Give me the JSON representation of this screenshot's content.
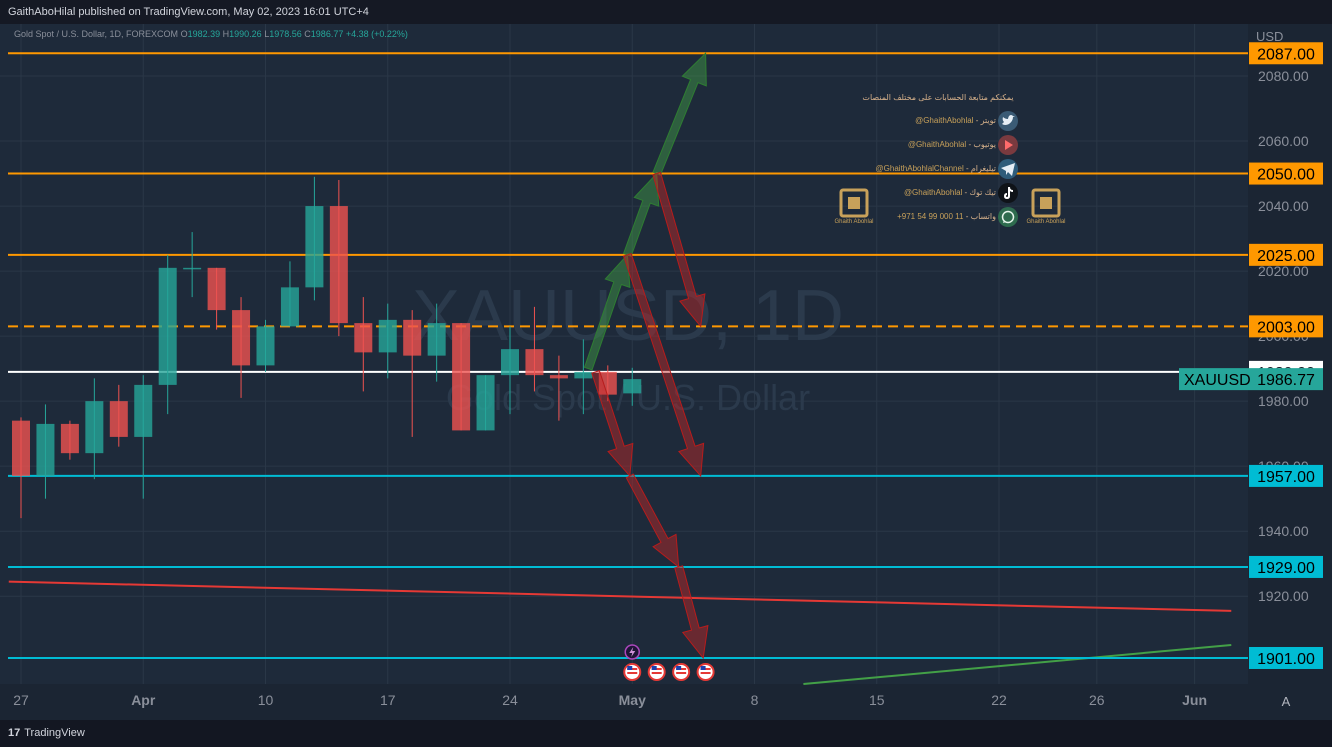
{
  "header": {
    "published": "GaithAboHilal published on TradingView.com, May 02, 2023 16:01 UTC+4"
  },
  "legend": {
    "symbol": "Gold Spot / U.S. Dollar, 1D, FOREXCOM",
    "o_label": "O",
    "o_value": "1982.39",
    "h_label": "H",
    "h_value": "1990.26",
    "l_label": "L",
    "l_value": "1978.56",
    "c_label": "C",
    "c_value": "1986.77",
    "change": "+4.38 (+0.22%)"
  },
  "footer": {
    "logo": "TradingView"
  },
  "watermark": {
    "line1": "XAUUSD, 1D",
    "line2": "Gold Spot / U.S. Dollar"
  },
  "social": {
    "heading": "يمكنكم متابعة الحسابات على مختلف المنصات",
    "items": [
      {
        "handle": "@GhaithAbohlal",
        "label": "تويتر",
        "icon": "twitter-icon",
        "color": "#1d9bf0"
      },
      {
        "handle": "@GhaithAbohlal",
        "label": "يوتيوب",
        "icon": "youtube-icon",
        "color": "#e53935"
      },
      {
        "handle": "@GhaithAbohlalChannel",
        "label": "تيليغرام",
        "icon": "telegram-icon",
        "color": "#2aa3de"
      },
      {
        "handle": "@GhaithAbohlal",
        "label": "تيك توك",
        "icon": "tiktok-icon",
        "color": "#111111"
      },
      {
        "handle": "+971 54 99 000 11",
        "label": "واتساب",
        "icon": "whatsapp-icon",
        "color": "#25d366"
      }
    ],
    "logo_caption": "Ghaith Abohlal"
  },
  "colors": {
    "background": "#1e2a3a",
    "up": "#26a69a",
    "down": "#ef5350",
    "orange": "#ff9800",
    "cyan": "#00bcd4",
    "price_tag": "#26a69a"
  },
  "chart_data": {
    "type": "candlestick",
    "symbol": "XAUUSD",
    "timeframe": "1D",
    "currency": "USD",
    "ylim": [
      1893,
      2096
    ],
    "yticks": [
      1920,
      1940,
      1960,
      1980,
      2000,
      2020,
      2040,
      2060,
      2080
    ],
    "xticks": [
      {
        "label": "27",
        "i": 0
      },
      {
        "label": "Apr",
        "i": 5
      },
      {
        "label": "10",
        "i": 10
      },
      {
        "label": "17",
        "i": 15
      },
      {
        "label": "24",
        "i": 20
      },
      {
        "label": "May",
        "i": 25
      },
      {
        "label": "8",
        "i": 30
      },
      {
        "label": "15",
        "i": 35
      },
      {
        "label": "22",
        "i": 40
      },
      {
        "label": "26",
        "i": 44
      },
      {
        "label": "Jun",
        "i": 48
      }
    ],
    "candles": [
      {
        "o": 1974,
        "h": 1975,
        "l": 1944,
        "c": 1957
      },
      {
        "o": 1957,
        "h": 1979,
        "l": 1950,
        "c": 1973
      },
      {
        "o": 1973,
        "h": 1974,
        "l": 1962,
        "c": 1964
      },
      {
        "o": 1964,
        "h": 1987,
        "l": 1956,
        "c": 1980
      },
      {
        "o": 1980,
        "h": 1985,
        "l": 1966,
        "c": 1969
      },
      {
        "o": 1969,
        "h": 1988,
        "l": 1950,
        "c": 1985
      },
      {
        "o": 1985,
        "h": 2025,
        "l": 1976,
        "c": 2021
      },
      {
        "o": 2021,
        "h": 2032,
        "l": 2012,
        "c": 2021
      },
      {
        "o": 2021,
        "h": 2021,
        "l": 2002,
        "c": 2008
      },
      {
        "o": 2008,
        "h": 2012,
        "l": 1981,
        "c": 1991
      },
      {
        "o": 1991,
        "h": 2005,
        "l": 1989,
        "c": 2003
      },
      {
        "o": 2003,
        "h": 2023,
        "l": 2003,
        "c": 2015
      },
      {
        "o": 2015,
        "h": 2049,
        "l": 2011,
        "c": 2040
      },
      {
        "o": 2040,
        "h": 2048,
        "l": 2000,
        "c": 2004
      },
      {
        "o": 2004,
        "h": 2012,
        "l": 1983,
        "c": 1995
      },
      {
        "o": 1995,
        "h": 2010,
        "l": 1987,
        "c": 2005
      },
      {
        "o": 2005,
        "h": 2008,
        "l": 1969,
        "c": 1994
      },
      {
        "o": 1994,
        "h": 2010,
        "l": 1986,
        "c": 2004
      },
      {
        "o": 2004,
        "h": 2004,
        "l": 1971,
        "c": 1971
      },
      {
        "o": 1971,
        "h": 1988,
        "l": 1971,
        "c": 1988
      },
      {
        "o": 1988,
        "h": 2003,
        "l": 1976,
        "c": 1996
      },
      {
        "o": 1996,
        "h": 2009,
        "l": 1983,
        "c": 1988
      },
      {
        "o": 1988,
        "h": 1994,
        "l": 1974,
        "c": 1987
      },
      {
        "o": 1987,
        "h": 1999,
        "l": 1976,
        "c": 1989
      },
      {
        "o": 1989,
        "h": 1991,
        "l": 1980,
        "c": 1982
      },
      {
        "o": 1982.39,
        "h": 1990.26,
        "l": 1978.56,
        "c": 1986.77
      }
    ],
    "hlines": [
      {
        "value": 2087.0,
        "label": "2087.00",
        "color": "#ff9800",
        "style": "solid"
      },
      {
        "value": 2050.0,
        "label": "2050.00",
        "color": "#ff9800",
        "style": "solid"
      },
      {
        "value": 2025.0,
        "label": "2025.00",
        "color": "#ff9800",
        "style": "solid"
      },
      {
        "value": 2003.0,
        "label": "2003.00",
        "color": "#ff9800",
        "style": "dashed"
      },
      {
        "value": 1989.0,
        "label": "1989.00",
        "color": "#ffffff",
        "style": "solid"
      },
      {
        "value": 1957.0,
        "label": "1957.00",
        "color": "#00bcd4",
        "style": "solid"
      },
      {
        "value": 1929.0,
        "label": "1929.00",
        "color": "#00bcd4",
        "style": "solid"
      },
      {
        "value": 1901.0,
        "label": "1901.00",
        "color": "#00bcd4",
        "style": "solid"
      }
    ],
    "price_tag": {
      "symbol": "XAUUSD",
      "value": "1986.77"
    },
    "trendlines": [
      {
        "from": {
          "i": -0.5,
          "y": 1924.5
        },
        "to": {
          "i": 49.5,
          "y": 1915.5
        },
        "color": "#e53935"
      },
      {
        "from": {
          "i": 32,
          "y": 1893
        },
        "to": {
          "i": 49.5,
          "y": 1905
        },
        "color": "#43a047"
      }
    ],
    "arrows": [
      {
        "from": {
          "i": 23.2,
          "y": 1990
        },
        "to": {
          "i": 24.8,
          "y": 2025
        },
        "color": "green"
      },
      {
        "from": {
          "i": 24.8,
          "y": 2025
        },
        "to": {
          "i": 26.0,
          "y": 2050
        },
        "color": "green"
      },
      {
        "from": {
          "i": 26.0,
          "y": 2050
        },
        "to": {
          "i": 28.0,
          "y": 2087
        },
        "color": "green"
      },
      {
        "from": {
          "i": 26.0,
          "y": 2050
        },
        "to": {
          "i": 27.8,
          "y": 2003
        },
        "color": "red"
      },
      {
        "from": {
          "i": 24.8,
          "y": 2025
        },
        "to": {
          "i": 27.8,
          "y": 1957
        },
        "color": "red"
      },
      {
        "from": {
          "i": 23.5,
          "y": 1989
        },
        "to": {
          "i": 24.9,
          "y": 1957
        },
        "color": "red"
      },
      {
        "from": {
          "i": 24.9,
          "y": 1957
        },
        "to": {
          "i": 26.9,
          "y": 1929
        },
        "color": "red"
      },
      {
        "from": {
          "i": 26.9,
          "y": 1929
        },
        "to": {
          "i": 27.9,
          "y": 1901
        },
        "color": "red"
      }
    ],
    "events": [
      {
        "i": 25,
        "kind": "lightning-icon"
      },
      {
        "i": 25,
        "kind": "us-flag-icon"
      },
      {
        "i": 26,
        "kind": "us-flag-icon"
      },
      {
        "i": 27,
        "kind": "us-flag-icon"
      },
      {
        "i": 28,
        "kind": "us-flag-icon"
      }
    ],
    "corner_label": "A"
  }
}
